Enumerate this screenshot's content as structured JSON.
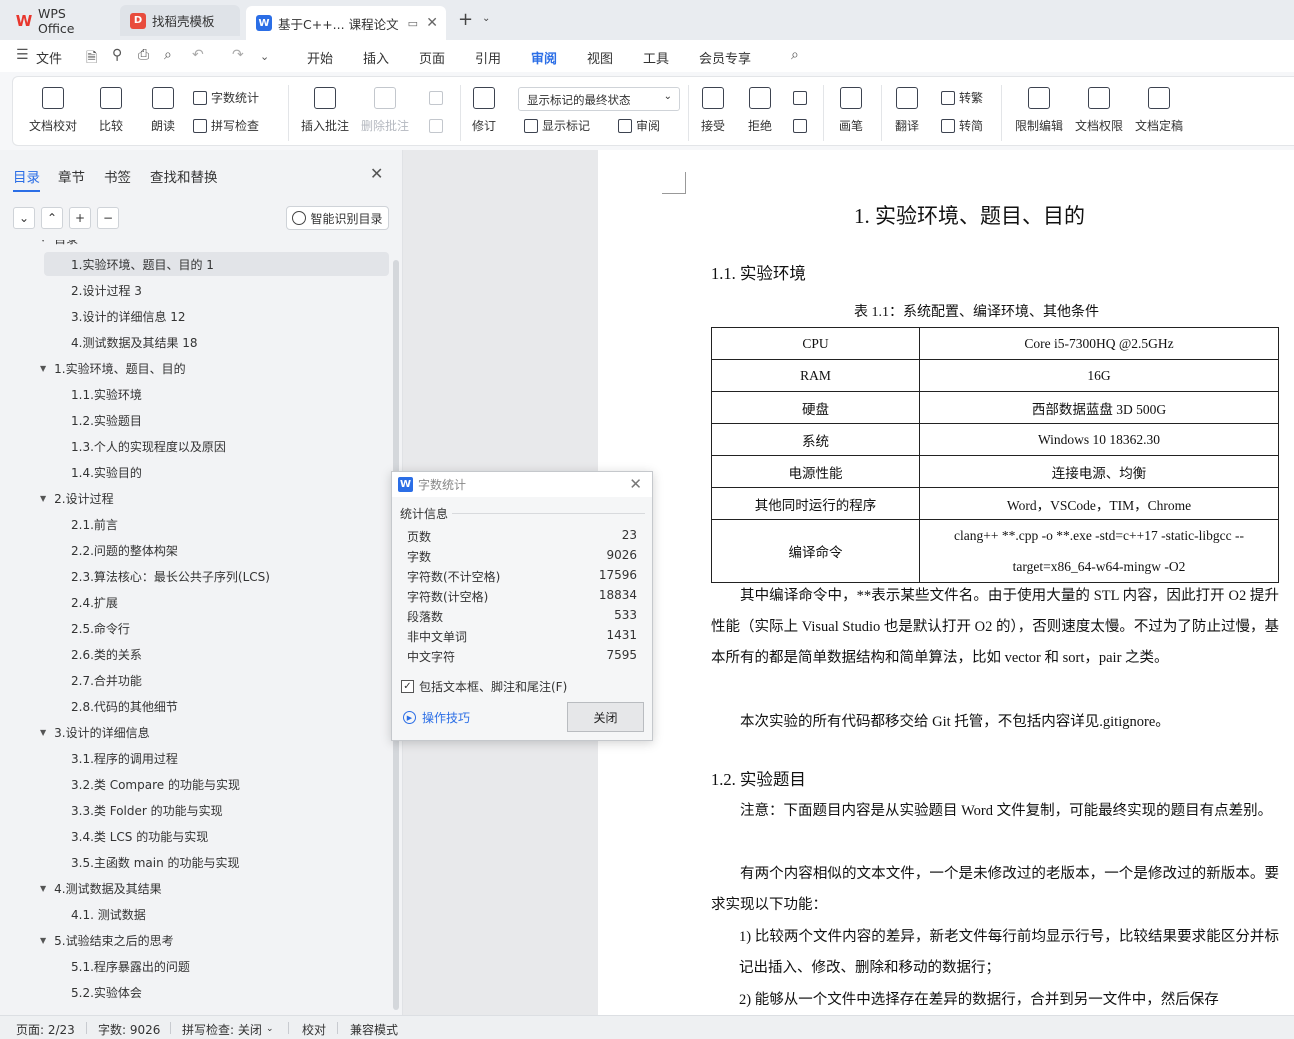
{
  "tabs": {
    "wps": "WPS Office",
    "template": "找稻壳模板",
    "doc": "基于C++... 课程论文",
    "add": "+",
    "add_arrow": "⌄"
  },
  "menu": {
    "file": "文件",
    "items": [
      "开始",
      "插入",
      "页面",
      "引用",
      "审阅",
      "视图",
      "工具",
      "会员专享"
    ],
    "active": "审阅"
  },
  "ribbon": {
    "doc_check": "文档校对",
    "compare": "比较",
    "read": "朗读",
    "word_count": "字数统计",
    "spell_check": "拼写检查",
    "insert_comment": "插入批注",
    "delete_comment": "删除批注",
    "track": "修订",
    "display_state": "显示标记的最终状态",
    "show_markup": "显示标记",
    "review": "审阅",
    "accept": "接受",
    "reject": "拒绝",
    "pen": "画笔",
    "translate": "翻译",
    "to_trad": "转繁",
    "to_simp": "转简",
    "restrict_edit": "限制编辑",
    "doc_perm": "文档权限",
    "doc_final": "文档定稿"
  },
  "panel": {
    "tabs": [
      "目录",
      "章节",
      "书签",
      "查找和替换"
    ],
    "smart_btn": "智能识别目录",
    "ctrl": [
      "⌄",
      "⌃",
      "+",
      "−"
    ],
    "toc": [
      {
        "label": "目录",
        "level": 0,
        "twisty": true
      },
      {
        "label": "1.实验环境、题目、目的  1",
        "level": 1,
        "selected": true
      },
      {
        "label": "2.设计过程  3",
        "level": 1
      },
      {
        "label": "3.设计的详细信息  12",
        "level": 1
      },
      {
        "label": "4.测试数据及其结果  18",
        "level": 1
      },
      {
        "label": "1.实验环境、题目、目的",
        "level": 0,
        "twisty": true
      },
      {
        "label": "1.1.实验环境",
        "level": 1
      },
      {
        "label": "1.2.实验题目",
        "level": 1
      },
      {
        "label": "1.3.个人的实现程度以及原因",
        "level": 1
      },
      {
        "label": "1.4.实验目的",
        "level": 1
      },
      {
        "label": "2.设计过程",
        "level": 0,
        "twisty": true
      },
      {
        "label": "2.1.前言",
        "level": 1
      },
      {
        "label": "2.2.问题的整体构架",
        "level": 1
      },
      {
        "label": "2.3.算法核心：最长公共子序列(LCS)",
        "level": 1
      },
      {
        "label": "2.4.扩展",
        "level": 1
      },
      {
        "label": "2.5.命令行",
        "level": 1
      },
      {
        "label": "2.6.类的关系",
        "level": 1
      },
      {
        "label": "2.7.合并功能",
        "level": 1
      },
      {
        "label": "2.8.代码的其他细节",
        "level": 1
      },
      {
        "label": "3.设计的详细信息",
        "level": 0,
        "twisty": true
      },
      {
        "label": "3.1.程序的调用过程",
        "level": 1
      },
      {
        "label": "3.2.类 Compare 的功能与实现",
        "level": 1
      },
      {
        "label": "3.3.类 Folder 的功能与实现",
        "level": 1
      },
      {
        "label": "3.4.类 LCS 的功能与实现",
        "level": 1
      },
      {
        "label": "3.5.主函数 main 的功能与实现",
        "level": 1
      },
      {
        "label": "4.测试数据及其结果",
        "level": 0,
        "twisty": true
      },
      {
        "label": "4.1. 测试数据",
        "level": 1
      },
      {
        "label": "5.试验结束之后的思考",
        "level": 0,
        "twisty": true
      },
      {
        "label": "5.1.程序暴露出的问题",
        "level": 1
      },
      {
        "label": "5.2.实验体会",
        "level": 1
      }
    ]
  },
  "doc": {
    "h1": "1.   实验环境、题目、目的",
    "h2_env": "1.1.    实验环境",
    "table_caption": "表  1.1：系统配置、编译环境、其他条件",
    "table": [
      [
        "CPU",
        "Core i5-7300HQ @2.5GHz"
      ],
      [
        "RAM",
        "16G"
      ],
      [
        "硬盘",
        "西部数据蓝盘  3D 500G"
      ],
      [
        "系统",
        "Windows 10 18362.30"
      ],
      [
        "电源性能",
        "连接电源、均衡"
      ],
      [
        "其他同时运行的程序",
        "Word，VSCode，TIM，Chrome"
      ],
      [
        "编译命令",
        "clang++ **.cpp -o **.exe -std=c++17 -static-libgcc --target=x86_64-w64-mingw -O2"
      ]
    ],
    "p1": "其中编译命令中，**表示某些文件名。由于使用大量的 STL 内容，因此打开 O2 提升性能（实际上 Visual Studio 也是默认打开 O2 的），否则速度太慢。不过为了防止过慢，基本所有的都是简单数据结构和简单算法，比如 vector 和 sort，pair 之类。",
    "p2": "本次实验的所有代码都移交给 Git 托管，不包括内容详见.gitignore。",
    "h2_task": "1.2.    实验题目",
    "p3": "注意：下面题目内容是从实验题目 Word 文件复制，可能最终实现的题目有点差别。",
    "p4": "有两个内容相似的文本文件，一个是未修改过的老版本，一个是修改过的新版本。要求实现以下功能：",
    "li1": "1)    比较两个文件内容的差异，新老文件每行前均显示行号，比较结果要求能区分并标记出插入、修改、删除和移动的数据行；",
    "li2": "2)    能够从一个文件中选择存在差异的数据行，合并到另一文件中，然后保存"
  },
  "dialog": {
    "title": "字数统计",
    "section": "统计信息",
    "stats": [
      {
        "label": "页数",
        "value": "23"
      },
      {
        "label": "字数",
        "value": "9026"
      },
      {
        "label": "字符数(不计空格)",
        "value": "17596"
      },
      {
        "label": "字符数(计空格)",
        "value": "18834"
      },
      {
        "label": "段落数",
        "value": "533"
      },
      {
        "label": "非中文单词",
        "value": "1431"
      },
      {
        "label": "中文字符",
        "value": "7595"
      }
    ],
    "checkbox": "包括文本框、脚注和尾注(F)",
    "checked": true,
    "tips": "操作技巧",
    "close": "关闭"
  },
  "statusbar": {
    "page": "页面: 2/23",
    "words": "字数: 9026",
    "spell": "拼写检查: 关闭",
    "proof": "校对",
    "compat": "兼容模式"
  },
  "colors": {
    "accent": "#2b6ee6",
    "tab_bg": "#e9ecf0",
    "panel_bg": "#f2f3f5"
  }
}
